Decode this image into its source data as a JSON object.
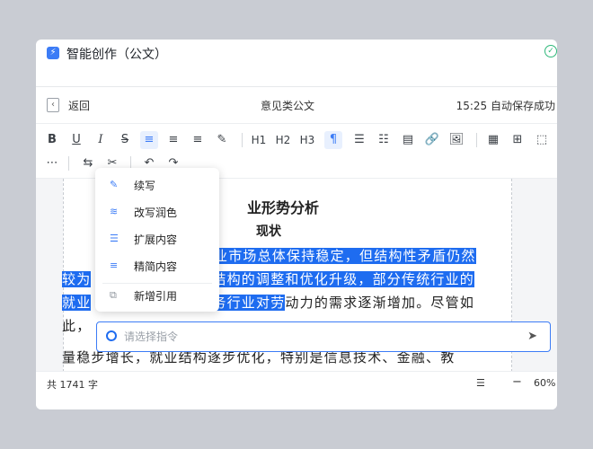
{
  "app": {
    "title": "智能创作（公文）",
    "icon": "lightning-icon",
    "status_icon": "check-circle-icon"
  },
  "nav": {
    "back_label": "返回",
    "doc_title": "意见类公文",
    "save_status": "15:25 自动保存成功"
  },
  "toolbar": {
    "row1": [
      "B",
      "U",
      "I",
      "S",
      "≡",
      "≡",
      "≡",
      "✎",
      "|",
      "H1",
      "H2",
      "H3",
      "¶",
      "☰",
      "☷",
      "▤",
      "🔗",
      "🖼",
      "|",
      "▦",
      "⊞",
      "⬚"
    ],
    "row2": [
      "⋯",
      "|",
      "⇆",
      "✂",
      "|",
      "↶",
      "↷"
    ]
  },
  "document": {
    "heading1": "业形势分析",
    "heading2": "现状",
    "lines": [
      {
        "sel": "业市场总体保持稳定，但结构性矛盾仍然",
        "rest": ""
      },
      {
        "sel": "较为",
        "mid": "结构的调整和优化升级，部分传统行业的",
        "rest": ""
      },
      {
        "sel": "就业",
        "mid": "务行业对劳",
        "rest": "动力的需求逐渐增加。尽管如"
      },
      {
        "sel": "",
        "rest": "此，"
      },
      {
        "sel": "",
        "rest": "量稳步增长，就业结构逐步优化，特别是信息技术、金融、教"
      }
    ]
  },
  "ai_menu": {
    "items": [
      {
        "label": "续写",
        "icon": "pen-icon"
      },
      {
        "label": "改写润色",
        "icon": "rewrite-icon"
      },
      {
        "label": "扩展内容",
        "icon": "expand-icon"
      },
      {
        "label": "精简内容",
        "icon": "condense-icon"
      },
      {
        "label": "新增引用",
        "icon": "quote-icon"
      }
    ]
  },
  "command_bar": {
    "placeholder": "请选择指令"
  },
  "statusbar": {
    "word_count": "共 1741 字",
    "zoom": "60%"
  }
}
